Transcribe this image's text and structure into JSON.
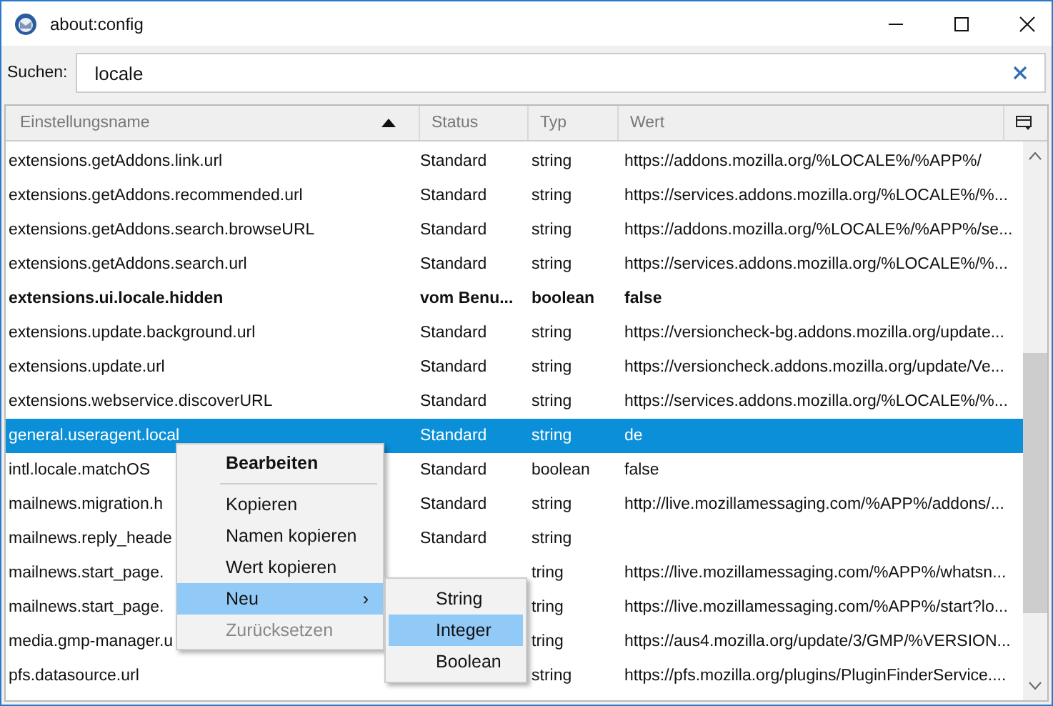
{
  "window": {
    "title": "about:config"
  },
  "search": {
    "label": "Suchen:",
    "value": "locale"
  },
  "table": {
    "columns": [
      {
        "label": "Einstellungsname",
        "sorted": true
      },
      {
        "label": "Status",
        "sorted": false
      },
      {
        "label": "Typ",
        "sorted": false
      },
      {
        "label": "Wert",
        "sorted": false
      }
    ],
    "rows": [
      {
        "name": "extensions.getAddons.link.url",
        "status": "Standard",
        "type": "string",
        "value": "https://addons.mozilla.org/%LOCALE%/%APP%/",
        "modified": false,
        "selected": false
      },
      {
        "name": "extensions.getAddons.recommended.url",
        "status": "Standard",
        "type": "string",
        "value": "https://services.addons.mozilla.org/%LOCALE%/%...",
        "modified": false,
        "selected": false
      },
      {
        "name": "extensions.getAddons.search.browseURL",
        "status": "Standard",
        "type": "string",
        "value": "https://addons.mozilla.org/%LOCALE%/%APP%/se...",
        "modified": false,
        "selected": false
      },
      {
        "name": "extensions.getAddons.search.url",
        "status": "Standard",
        "type": "string",
        "value": "https://services.addons.mozilla.org/%LOCALE%/%...",
        "modified": false,
        "selected": false
      },
      {
        "name": "extensions.ui.locale.hidden",
        "status": "vom Benu...",
        "type": "boolean",
        "value": "false",
        "modified": true,
        "selected": false
      },
      {
        "name": "extensions.update.background.url",
        "status": "Standard",
        "type": "string",
        "value": "https://versioncheck-bg.addons.mozilla.org/update...",
        "modified": false,
        "selected": false
      },
      {
        "name": "extensions.update.url",
        "status": "Standard",
        "type": "string",
        "value": "https://versioncheck.addons.mozilla.org/update/Ve...",
        "modified": false,
        "selected": false
      },
      {
        "name": "extensions.webservice.discoverURL",
        "status": "Standard",
        "type": "string",
        "value": "https://services.addons.mozilla.org/%LOCALE%/%...",
        "modified": false,
        "selected": false
      },
      {
        "name": "general.useragent.local",
        "status": "Standard",
        "type": "string",
        "value": "de",
        "modified": false,
        "selected": true
      },
      {
        "name": "intl.locale.matchOS",
        "status": "Standard",
        "type": "boolean",
        "value": "false",
        "modified": false,
        "selected": false
      },
      {
        "name": "mailnews.migration.h",
        "status": "Standard",
        "type": "string",
        "value": "http://live.mozillamessaging.com/%APP%/addons/...",
        "modified": false,
        "selected": false
      },
      {
        "name": "mailnews.reply_heade",
        "status": "Standard",
        "type": "string",
        "value": "",
        "modified": false,
        "selected": false
      },
      {
        "name": "mailnews.start_page.",
        "status": "",
        "type": "tring",
        "value": "https://live.mozillamessaging.com/%APP%/whatsn...",
        "modified": false,
        "selected": false
      },
      {
        "name": "mailnews.start_page.",
        "status": "",
        "type": "tring",
        "value": "https://live.mozillamessaging.com/%APP%/start?lo...",
        "modified": false,
        "selected": false
      },
      {
        "name": "media.gmp-manager.u",
        "status": "",
        "type": "tring",
        "value": "https://aus4.mozilla.org/update/3/GMP/%VERSION...",
        "modified": false,
        "selected": false
      },
      {
        "name": "pfs.datasource.url",
        "status": "",
        "type": "string",
        "value": "https://pfs.mozilla.org/plugins/PluginFinderService....",
        "modified": false,
        "selected": false
      }
    ]
  },
  "context_menu": {
    "items": [
      {
        "label": "Bearbeiten",
        "kind": "default",
        "disabled": false,
        "selected": false
      },
      {
        "kind": "separator"
      },
      {
        "label": "Kopieren",
        "kind": "item",
        "disabled": false,
        "selected": false
      },
      {
        "label": "Namen kopieren",
        "kind": "item",
        "disabled": false,
        "selected": false
      },
      {
        "label": "Wert kopieren",
        "kind": "item",
        "disabled": false,
        "selected": false
      },
      {
        "label": "Neu",
        "kind": "submenu",
        "disabled": false,
        "selected": true,
        "arrow": "›"
      },
      {
        "label": "Zurücksetzen",
        "kind": "item",
        "disabled": true,
        "selected": false
      }
    ]
  },
  "submenu": {
    "items": [
      {
        "label": "String",
        "selected": false
      },
      {
        "label": "Integer",
        "selected": true
      },
      {
        "label": "Boolean",
        "selected": false
      }
    ]
  }
}
